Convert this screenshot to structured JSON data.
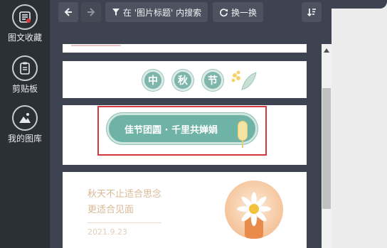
{
  "sidebar": {
    "items": [
      {
        "label": "图文收藏",
        "icon": "library-icon"
      },
      {
        "label": "剪贴板",
        "icon": "clipboard-icon"
      },
      {
        "label": "我的图库",
        "icon": "image-gallery-icon"
      }
    ]
  },
  "toolbar": {
    "back_icon": "arrow-left-icon",
    "forward_icon": "arrow-right-icon",
    "search_label": "在 '图片标题' 内搜索",
    "search_icon": "filter-icon",
    "swap_label": "换一换",
    "swap_icon": "refresh-icon",
    "sort_icon": "sort-icon"
  },
  "cards": {
    "festival_chars": [
      "中",
      "秋",
      "节"
    ],
    "title_pill": "佳节团圆 · 千里共婵娟",
    "article": {
      "line1": "秋天不止适合思念",
      "line2": "更适合见面",
      "date": "2021.9.23"
    }
  },
  "colors": {
    "accent_teal": "#6fb3a6",
    "selection_red": "#d9363e",
    "sidebar_bg": "#2b2f36",
    "panel_bg": "#3d4350"
  }
}
